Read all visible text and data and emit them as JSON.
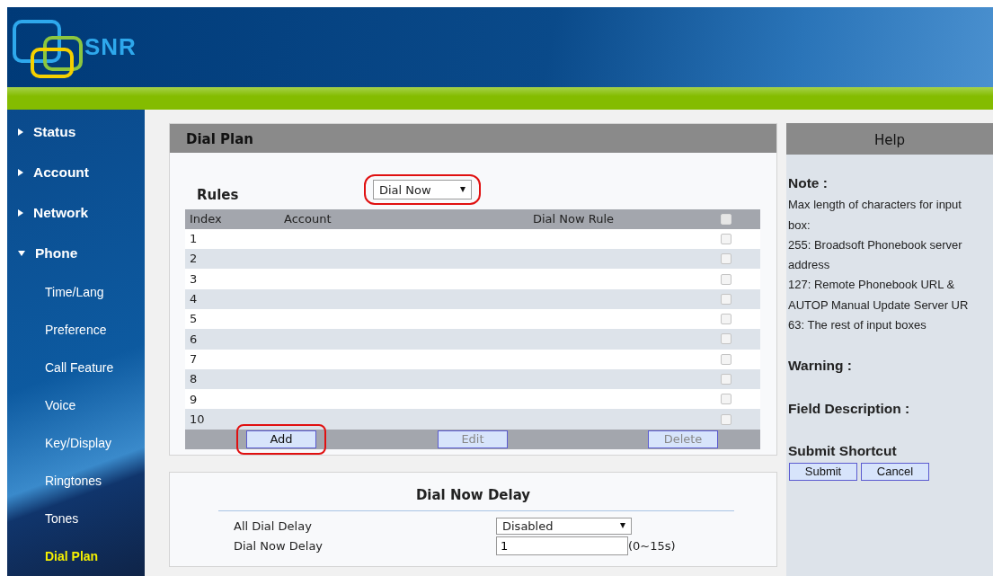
{
  "header": {
    "logo_text": "SNR"
  },
  "sidebar": {
    "items": [
      {
        "label": "Status",
        "expanded": false
      },
      {
        "label": "Account",
        "expanded": false
      },
      {
        "label": "Network",
        "expanded": false
      },
      {
        "label": "Phone",
        "expanded": true,
        "children": [
          {
            "label": "Time/Lang",
            "selected": false
          },
          {
            "label": "Preference",
            "selected": false
          },
          {
            "label": "Call Feature",
            "selected": false
          },
          {
            "label": "Voice",
            "selected": false
          },
          {
            "label": "Key/Display",
            "selected": false
          },
          {
            "label": "Ringtones",
            "selected": false
          },
          {
            "label": "Tones",
            "selected": false
          },
          {
            "label": "Dial Plan",
            "selected": true
          }
        ]
      }
    ]
  },
  "dial_plan": {
    "title": "Dial Plan",
    "rules_label": "Rules",
    "rule_type": {
      "value": "Dial Now",
      "highlighted": true
    },
    "table": {
      "columns": [
        "Index",
        "Account",
        "Dial Now Rule"
      ],
      "header_checked": false,
      "rows": [
        {
          "index": "1",
          "checked": false
        },
        {
          "index": "2",
          "checked": false
        },
        {
          "index": "3",
          "checked": false
        },
        {
          "index": "4",
          "checked": false
        },
        {
          "index": "5",
          "checked": false
        },
        {
          "index": "6",
          "checked": false
        },
        {
          "index": "7",
          "checked": false
        },
        {
          "index": "8",
          "checked": false
        },
        {
          "index": "9",
          "checked": false
        },
        {
          "index": "10",
          "checked": false
        }
      ],
      "buttons": [
        {
          "label": "Add",
          "disabled": false,
          "highlighted": true
        },
        {
          "label": "Edit",
          "disabled": true,
          "highlighted": false
        },
        {
          "label": "Delete",
          "disabled": true,
          "highlighted": false
        }
      ]
    }
  },
  "delay": {
    "title": "Dial Now Delay",
    "fields": [
      {
        "kind": "select",
        "label": "All Dial Delay",
        "value": "Disabled"
      },
      {
        "kind": "input",
        "label": "Dial Now Delay",
        "value": "1",
        "hint": "(0~15s)"
      }
    ]
  },
  "help": {
    "title": "Help",
    "sections": [
      {
        "heading": "Note :",
        "lines": [
          "Max length of characters for input",
          "box:",
          "255: Broadsoft Phonebook server",
          "address",
          "127: Remote Phonebook URL &",
          "AUTOP Manual Update Server UR",
          "63: The rest of input boxes"
        ]
      },
      {
        "heading": "Warning :"
      },
      {
        "heading": "Field Description :"
      },
      {
        "heading": "Submit Shortcut"
      }
    ],
    "buttons": [
      "Submit",
      "Cancel"
    ]
  }
}
